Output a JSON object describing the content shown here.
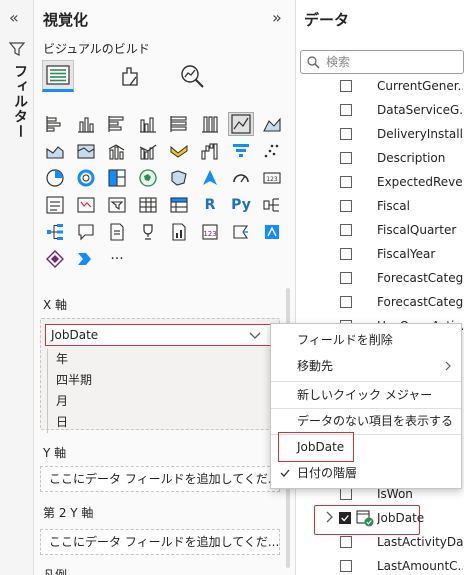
{
  "filters": {
    "label": "フィルター"
  },
  "visualizations": {
    "title": "視覚化",
    "build_label": "ビジュアルのビルド",
    "glyph_r": "R",
    "glyph_py": "Py",
    "more_label": "···"
  },
  "x_axis": {
    "title": "X 軸",
    "field": "JobDate",
    "hierarchy": [
      "年",
      "四半期",
      "月",
      "日"
    ]
  },
  "y_axis": {
    "title": "Y 軸",
    "placeholder": "ここにデータ フィールドを追加してくだ..."
  },
  "y2_axis": {
    "title": "第 2 Y 軸",
    "placeholder": "ここにデータ フィールドを追加してくだ..."
  },
  "legend": {
    "title": "凡例"
  },
  "data": {
    "title": "データ",
    "search_placeholder": "検索",
    "fields": [
      "CurrentGener...",
      "DataServiceG...",
      "DeliveryInstall...",
      "Description",
      "ExpectedReve...",
      "Fiscal",
      "FiscalQuarter",
      "FiscalYear",
      "ForecastCateg...",
      "ForecastCateg...",
      "HasOpenActiv..."
    ],
    "bottom_fields": [
      "IsWon",
      "JobDate",
      "LastActivityDate",
      "LastAmountC..."
    ]
  },
  "context_menu": {
    "remove_field": "フィールドを削除",
    "move_to": "移動先",
    "new_quick_measure": "新しいクイック メジャー",
    "show_items_no_data": "データのない項目を表示する",
    "jobdate": "JobDate",
    "date_hierarchy": "日付の階層"
  },
  "colors": {
    "accent": "#118dff",
    "highlight_border": "#d13438"
  }
}
